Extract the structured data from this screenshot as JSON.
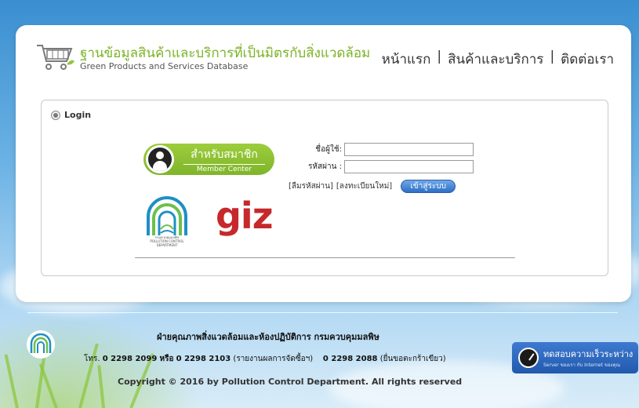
{
  "header": {
    "title_th": "ฐานข้อมูลสินค้าและบริการที่เป็นมิตรกับสิ่งแวดล้อม",
    "title_en": "Green Products and Services Database",
    "nav": [
      {
        "label": "หน้าแรก"
      },
      {
        "label": "สินค้าและบริการ"
      },
      {
        "label": "ติดต่อเรา"
      }
    ],
    "nav_separator": "|"
  },
  "login": {
    "heading": "Login",
    "member_badge_th": "สำหรับสมาชิก",
    "member_badge_en": "Member Center",
    "username_label": "ชื่อผู้ใช้:",
    "password_label": "รหัสผ่าน :",
    "username_value": "",
    "password_value": "",
    "forgot_password": "[ลืมรหัสผ่าน]",
    "register": "[ลงทะเบียนใหม่]",
    "login_button": "เข้าสู่ระบบ",
    "giz_logo_text": "giz",
    "pcd_logo_caption_th": "กรมควบคุมมลพิษ",
    "pcd_logo_caption_en": "POLLUTION CONTROL DEPARTMENT"
  },
  "footer": {
    "department": "ฝ่ายคุณภาพสิ่งแวดล้อมและห้องปฏิบัติการ กรมควบคุมมลพิษ",
    "phone_prefix": "โทร.",
    "phone_1": "0 2298 2099",
    "phone_or": "หรือ",
    "phone_2": "0 2298 2103",
    "phone_2_note": "(รายงานผลการจัดซื้อฯ)",
    "phone_3": "0 2298 2088",
    "phone_3_note": "(ยื่นขอตะกร้าเขียว)",
    "copyright": "Copyright © 2016 by Pollution Control Department. All rights reserved",
    "speedtest_title": "ทดสอบความเร็วระหว่าง",
    "speedtest_sub": "Server ของเรา กับ Internet ของคุณ"
  },
  "colors": {
    "brand_green": "#7ab325",
    "sky_blue": "#3a8fd0",
    "giz_red": "#c6282b",
    "button_blue": "#2d6fc7"
  },
  "icons": {
    "logo": "shopping-cart-icon",
    "login_radio": "radio-icon",
    "member": "user-avatar-icon",
    "speedtest": "speedometer-icon"
  }
}
